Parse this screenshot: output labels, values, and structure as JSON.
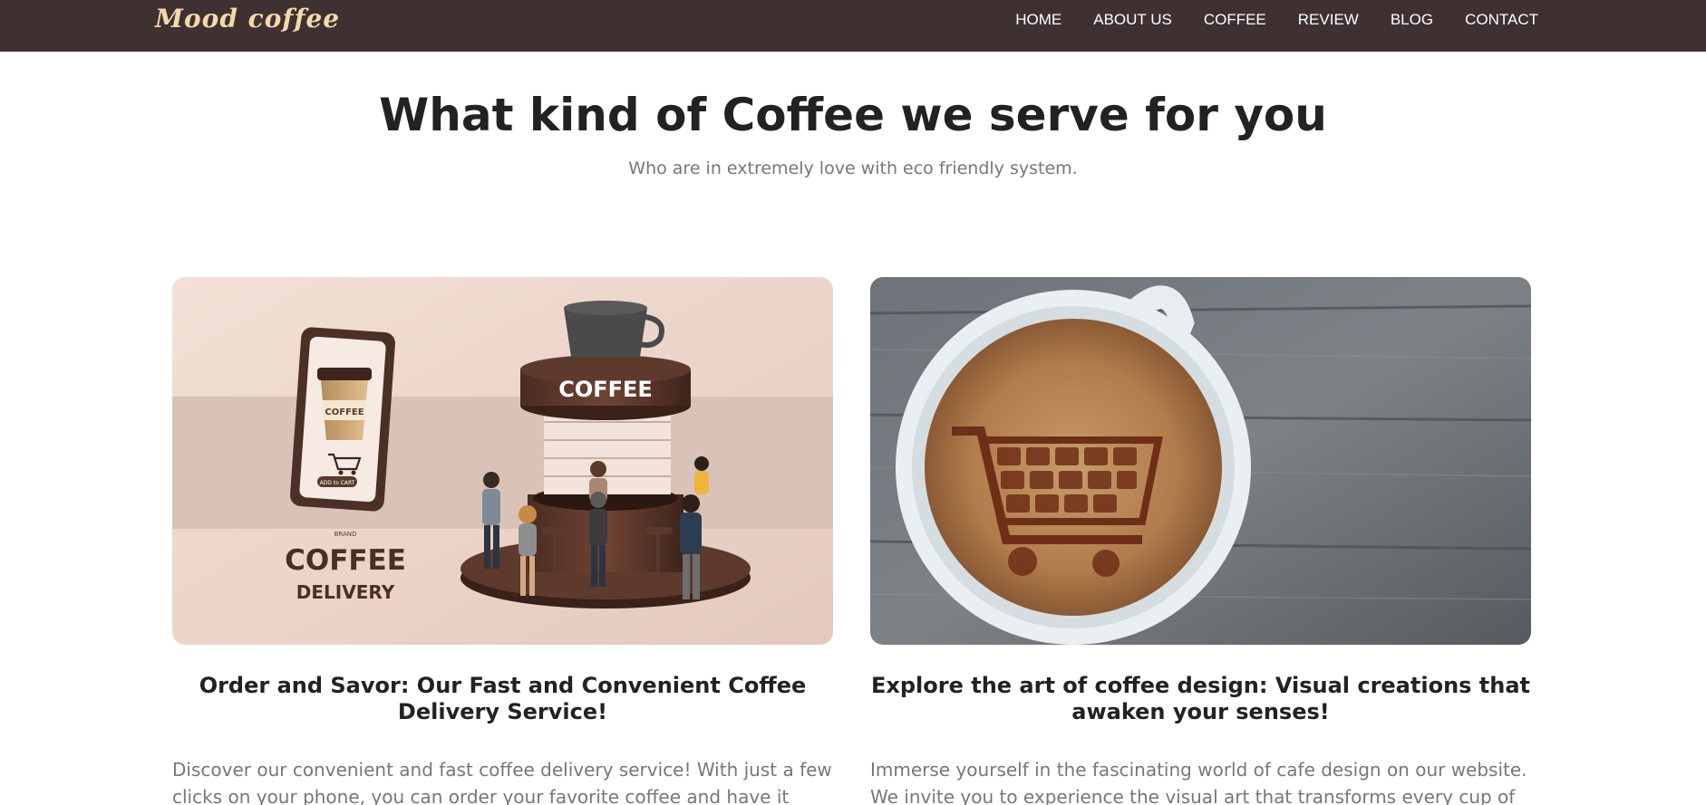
{
  "navbar": {
    "brand": "Mood coffee",
    "links": [
      "HOME",
      "ABOUT US",
      "COFFEE",
      "REVIEW",
      "BLOG",
      "CONTACT"
    ],
    "background": "#3f3131",
    "brand_color": "#f4d9ad"
  },
  "section": {
    "title": "What kind of Coffee we serve for you",
    "subtitle": "Who are in extremely love with eco friendly system."
  },
  "cards": [
    {
      "image": {
        "phone_cup_label": "COFFEE",
        "phone_button": "ADD to CART",
        "kiosk_sign": "COFFEE",
        "brand_small": "BRAND",
        "brand_big": "COFFEE",
        "brand_sub": "DELIVERY"
      },
      "title": "Order and Savor: Our Fast and Convenient Coffee Delivery Service!",
      "text": "Discover our convenient and fast coffee delivery service! With just a few clicks on your phone, you can order your favorite coffee and have it delivered to"
    },
    {
      "image": {},
      "title": "Explore the art of coffee design: Visual creations that awaken your senses!",
      "text": "Immerse yourself in the fascinating world of cafe design on our website. We invite you to experience the visual art that transforms every cup of coffee into"
    }
  ]
}
